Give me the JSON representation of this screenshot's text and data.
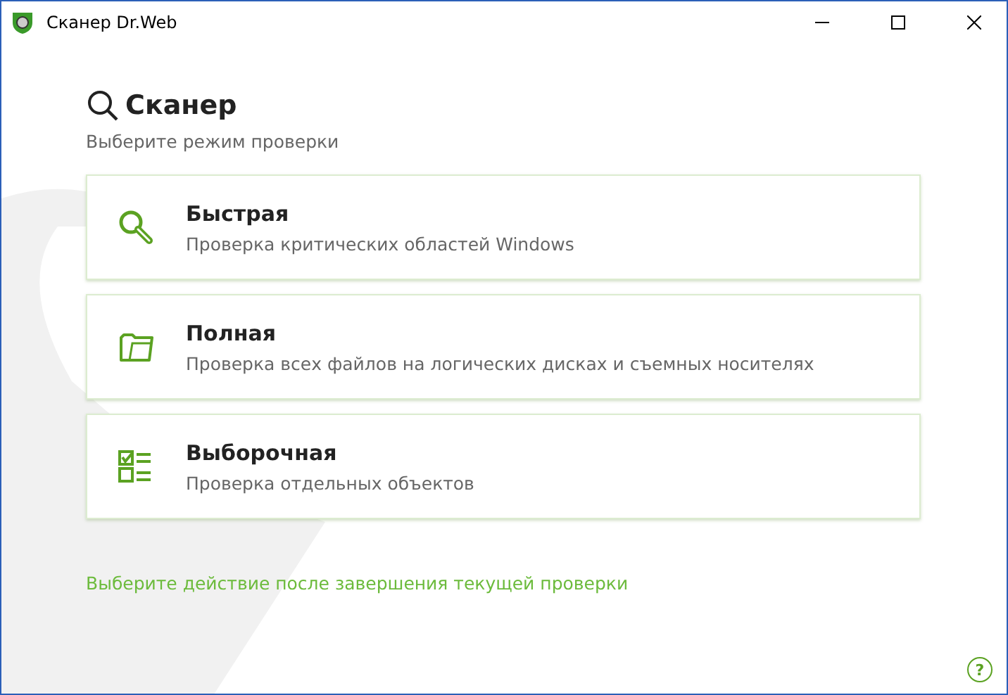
{
  "window": {
    "title": "Сканер Dr.Web"
  },
  "header": {
    "title": "Сканер",
    "subtitle": "Выберите режим проверки"
  },
  "modes": [
    {
      "kind": "quick",
      "title": "Быстрая",
      "description": "Проверка критических областей Windows"
    },
    {
      "kind": "full",
      "title": "Полная",
      "description": "Проверка всех файлов на логических дисках и съемных носителях"
    },
    {
      "kind": "custom",
      "title": "Выборочная",
      "description": "Проверка отдельных объектов"
    }
  ],
  "after_scan_link": "Выберите действие после завершения текущей проверки",
  "help": "?"
}
